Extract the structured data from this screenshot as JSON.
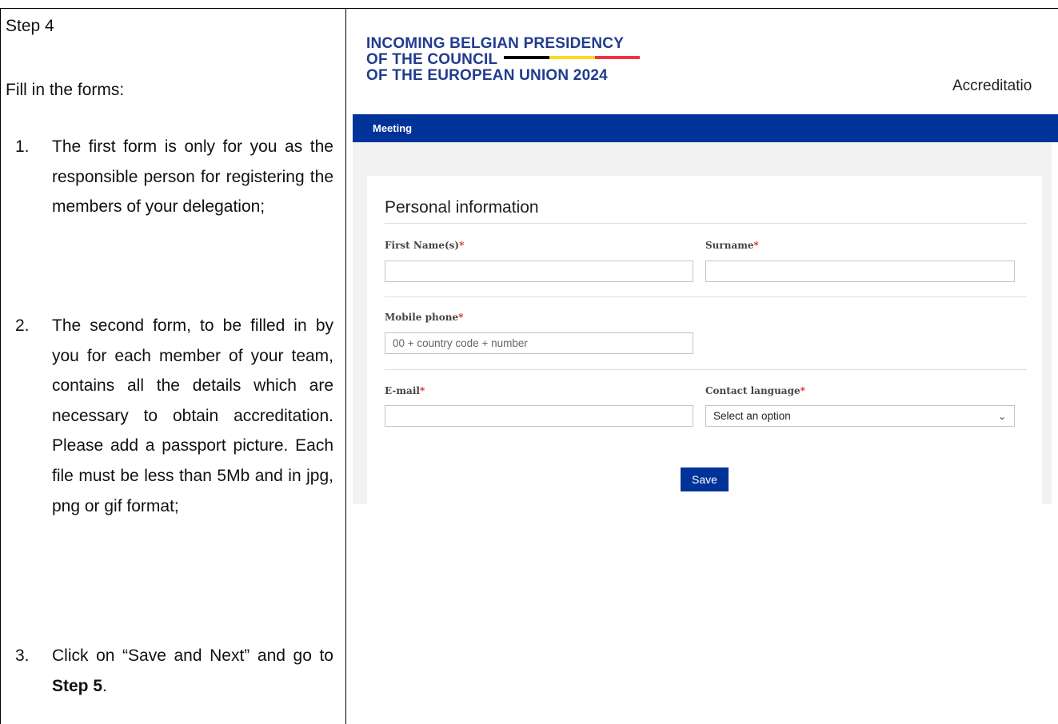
{
  "left": {
    "step_title": "Step 4",
    "fill_title": "Fill in the forms:",
    "items": [
      {
        "num": "1.",
        "text": "The first form is only for you as the responsible person for registering the members of your delegation;"
      },
      {
        "num": "2.",
        "text": "The second form, to be filled in by you for each member of your team, contains all the details which are necessary to obtain accreditation. Please add a passport picture. Each file must be less than 5Mb and in jpg, png or gif format;"
      },
      {
        "num": "3.",
        "text_before": "Click on “Save and Next” and go to ",
        "text_bold": "Step 5",
        "text_after": "."
      }
    ]
  },
  "logo": {
    "line1": "INCOMING BELGIAN PRESIDENCY",
    "line2": "OF THE COUNCIL",
    "line3": "OF THE EUROPEAN UNION 2024",
    "flag_colors": [
      "#000000",
      "#FDDA24",
      "#EF3340"
    ]
  },
  "header": {
    "accreditation": "Accreditatio"
  },
  "nav": {
    "item": "Meeting"
  },
  "form": {
    "section_title": "Personal information",
    "first_name_label": "First Name(s)",
    "surname_label": "Surname",
    "mobile_label": "Mobile phone",
    "mobile_placeholder": "00 + country code + number",
    "email_label": "E-mail",
    "language_label": "Contact language",
    "language_value": "Select an option",
    "required_mark": "*",
    "save_label": "Save"
  },
  "colors": {
    "brand_blue": "#003399",
    "logo_blue": "#213b8f",
    "required_red": "#d62828"
  }
}
